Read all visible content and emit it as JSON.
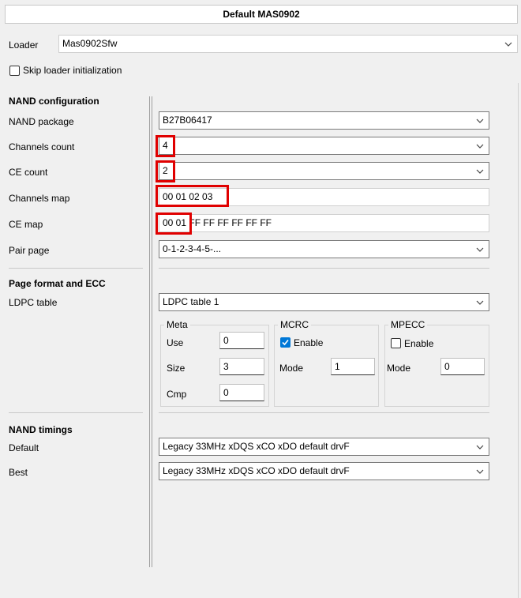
{
  "window_title": "Default MAS0902",
  "loader": {
    "label": "Loader",
    "value": "Mas0902Sfw"
  },
  "skip_loader": {
    "label": "Skip loader initialization",
    "checked": false
  },
  "nand_config": {
    "heading": "NAND configuration",
    "rows": {
      "package": {
        "label": "NAND package",
        "value": "B27B06417"
      },
      "channels_count": {
        "label": "Channels count",
        "value": "4"
      },
      "ce_count": {
        "label": "CE count",
        "value": "2"
      },
      "channels_map": {
        "label": "Channels map",
        "value": "00 01 02 03"
      },
      "ce_map": {
        "label": "CE map",
        "value": "00 01 FF FF FF FF FF FF"
      },
      "pair_page": {
        "label": "Pair page",
        "value": "0-1-2-3-4-5-..."
      }
    }
  },
  "page_format": {
    "heading": "Page format and ECC",
    "ldpc": {
      "label": "LDPC table",
      "value": "LDPC table 1"
    },
    "meta": {
      "title": "Meta",
      "use_label": "Use",
      "use_value": "0",
      "size_label": "Size",
      "size_value": "3",
      "cmp_label": "Cmp",
      "cmp_value": "0"
    },
    "mcrc": {
      "title": "MCRC",
      "enable_label": "Enable",
      "enabled": true,
      "mode_label": "Mode",
      "mode_value": "1"
    },
    "mpecc": {
      "title": "MPECC",
      "enable_label": "Enable",
      "enabled": false,
      "mode_label": "Mode",
      "mode_value": "0"
    }
  },
  "nand_timings": {
    "heading": "NAND timings",
    "default": {
      "label": "Default",
      "value": "Legacy 33MHz xDQS xCO xDO default drvF"
    },
    "best": {
      "label": "Best",
      "value": "Legacy 33MHz xDQS xCO xDO default drvF"
    }
  },
  "highlight_color": "#e00000",
  "accent_color": "#0078d7"
}
